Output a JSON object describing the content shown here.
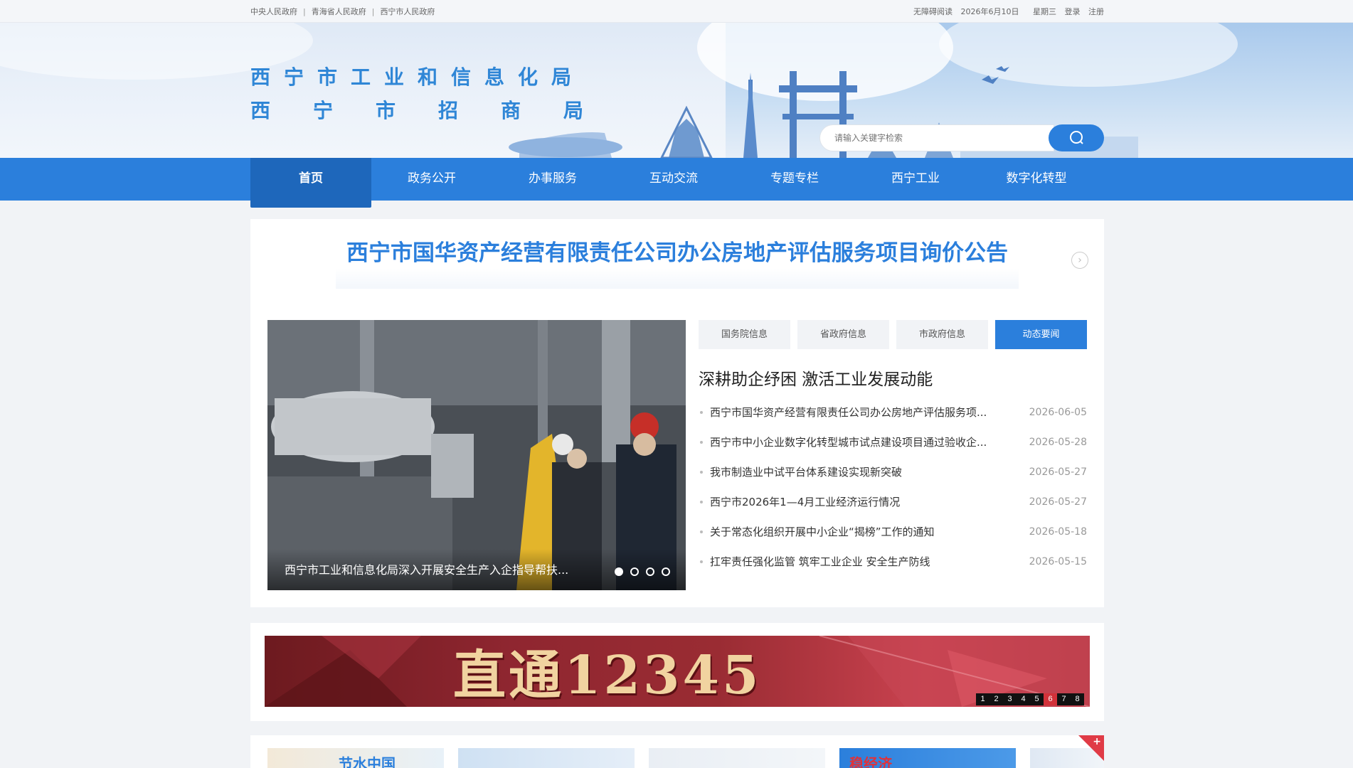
{
  "topbar": {
    "links": [
      "中央人民政府",
      "青海省人民政府",
      "西宁市人民政府"
    ],
    "separator": "|",
    "accessible": "无障碍阅读",
    "date": "2026年6月10日",
    "weekday": "星期三",
    "login": "登录",
    "register": "注册"
  },
  "header": {
    "title_line1": "西宁市工业和信息化局",
    "title_line2": "西宁市招商局",
    "search_placeholder": "请输入关键字检索"
  },
  "nav": {
    "items": [
      {
        "label": "首页",
        "active": true
      },
      {
        "label": "政务公开",
        "active": false
      },
      {
        "label": "办事服务",
        "active": false
      },
      {
        "label": "互动交流",
        "active": false
      },
      {
        "label": "专题专栏",
        "active": false
      },
      {
        "label": "西宁工业",
        "active": false
      },
      {
        "label": "数字化转型",
        "active": false
      }
    ]
  },
  "headline": "西宁市国华资产经营有限责任公司办公房地产评估服务项目询价公告",
  "carousel": {
    "caption": "西宁市工业和信息化局深入开展安全生产入企指导帮扶...",
    "total": 4,
    "current": 1
  },
  "tabs": [
    {
      "label": "国务院信息",
      "active": false
    },
    {
      "label": "省政府信息",
      "active": false
    },
    {
      "label": "市政府信息",
      "active": false
    },
    {
      "label": "动态要闻",
      "active": true
    }
  ],
  "lead_title": "深耕助企纾困 激活工业发展动能",
  "news": [
    {
      "title": "西宁市国华资产经营有限责任公司办公房地产评估服务项...",
      "date": "2026-06-05"
    },
    {
      "title": "西宁市中小企业数字化转型城市试点建设项目通过验收企...",
      "date": "2026-05-28"
    },
    {
      "title": "我市制造业中试平台体系建设实现新突破",
      "date": "2026-05-27"
    },
    {
      "title": "西宁市2026年1—4月工业经济运行情况",
      "date": "2026-05-27"
    },
    {
      "title": "关于常态化组织开展中小企业“揭榜”工作的通知",
      "date": "2026-05-18"
    },
    {
      "title": "扛牢责任强化监管 筑牢工业企业 安全生产防线",
      "date": "2026-05-15"
    }
  ],
  "banner": {
    "text": "直通12345",
    "pages": [
      "1",
      "2",
      "3",
      "4",
      "5",
      "6",
      "7",
      "8"
    ],
    "active_page": "6"
  },
  "thumbs": [
    {
      "label": "节水中国"
    },
    {
      "label": ""
    },
    {
      "label": ""
    },
    {
      "label": "稳经济"
    },
    {
      "label": ""
    }
  ],
  "corner_plus": "+",
  "next_arrow": "›",
  "colors": {
    "accent": "#2b7fdc",
    "nav_active": "#1e67bb",
    "banner_red": "#9a2c33",
    "pager_active": "#d2323a"
  }
}
